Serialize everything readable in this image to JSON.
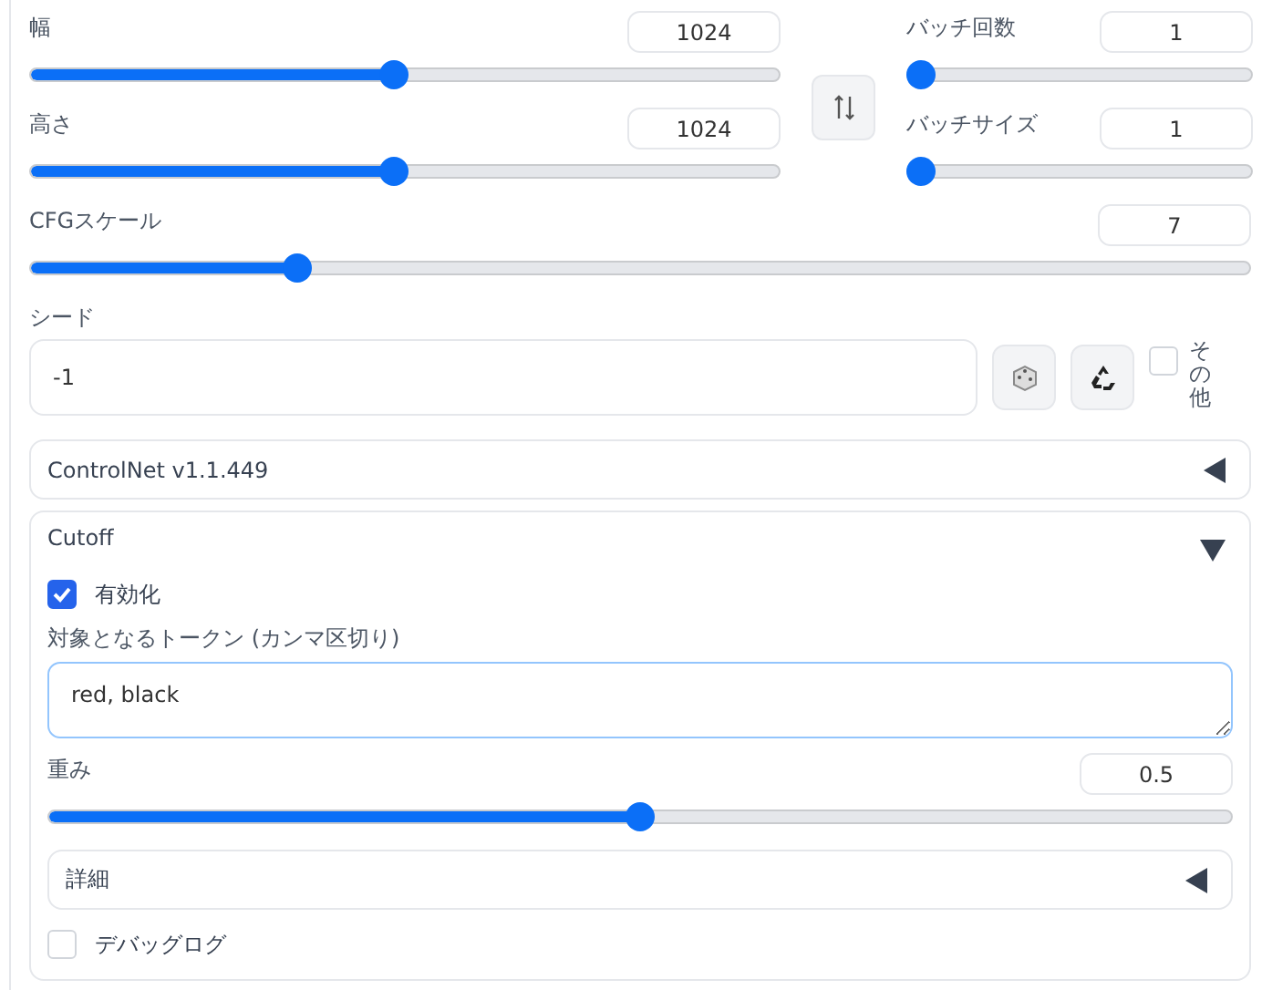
{
  "size_sliders": [
    {
      "label": "幅",
      "value": "1024",
      "level": 0.484
    },
    {
      "label": "高さ",
      "value": "1024",
      "level": 0.484
    }
  ],
  "batch_sliders": [
    {
      "label": "バッチ回数",
      "value": "1",
      "level": 0
    },
    {
      "label": "バッチサイズ",
      "value": "1",
      "level": 0
    }
  ],
  "cfg_scale": {
    "label": "CFGスケール",
    "value": "7",
    "level": 0.212
  },
  "seed": {
    "label": "シード",
    "value": "-1",
    "extra": {
      "label": "その他",
      "checked": false
    }
  },
  "controlnet": {
    "title": "ControlNet v1.1.449",
    "expanded": false
  },
  "cutoff": {
    "title": "Cutoff",
    "expanded": true,
    "enable": {
      "label": "有効化",
      "checked": true
    },
    "tokens": {
      "label": "対象となるトークン (カンマ区切り)",
      "value": "red, black"
    },
    "weight": {
      "label": "重み",
      "value": "0.5",
      "level": 0.5
    },
    "details": {
      "title": "詳細",
      "expanded": false
    },
    "debug_log": {
      "label": "デバッグログ",
      "checked": false
    }
  }
}
